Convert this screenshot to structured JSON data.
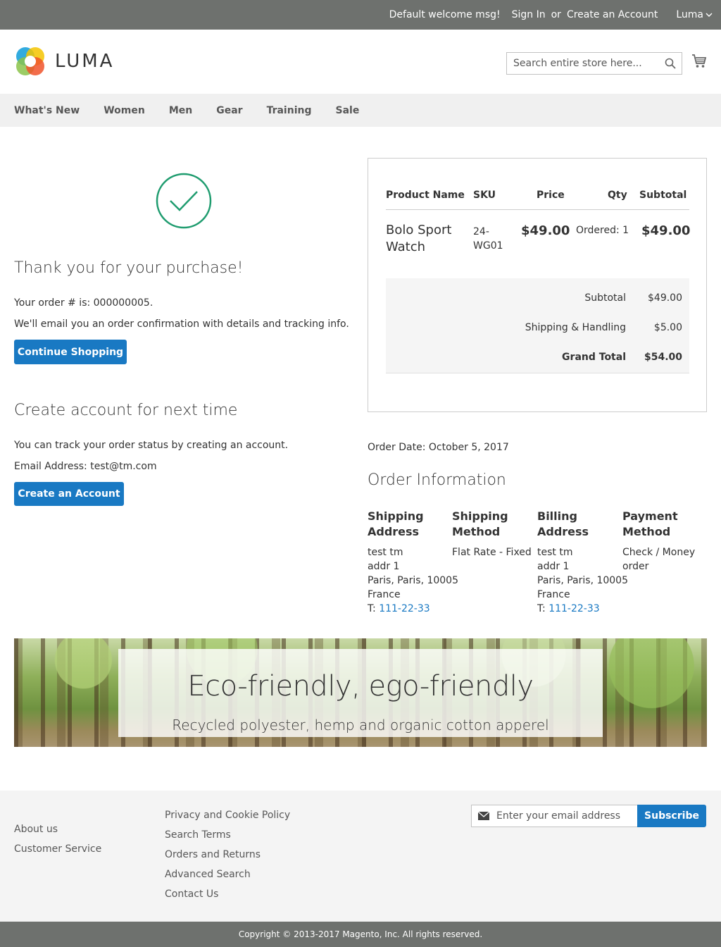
{
  "topbar": {
    "welcome": "Default welcome msg!",
    "sign_in": "Sign In",
    "or": "or",
    "create_account": "Create an Account",
    "store": "Luma"
  },
  "header": {
    "logo_text": "LUMA",
    "search_placeholder": "Search entire store here..."
  },
  "nav": [
    "What's New",
    "Women",
    "Men",
    "Gear",
    "Training",
    "Sale"
  ],
  "success": {
    "title": "Thank you for your purchase!",
    "order_number": "Your order # is: 000000005.",
    "email_note": "We'll email you an order confirmation with details and tracking info.",
    "continue_label": "Continue Shopping"
  },
  "create": {
    "title": "Create account for next time",
    "track_note": "You can track your order status by creating an account.",
    "email": "Email Address: test@tm.com",
    "button": "Create an Account"
  },
  "summary": {
    "headers": {
      "product": "Product Name",
      "sku": "SKU",
      "price": "Price",
      "qty": "Qty",
      "subtotal": "Subtotal"
    },
    "item": {
      "name": "Bolo Sport Watch",
      "sku": "24-WG01",
      "price": "$49.00",
      "qty": "Ordered: 1",
      "subtotal": "$49.00"
    },
    "totals": [
      {
        "label": "Subtotal",
        "value": "$49.00"
      },
      {
        "label": "Shipping & Handling",
        "value": "$5.00"
      },
      {
        "label": "Grand Total",
        "value": "$54.00"
      }
    ]
  },
  "order": {
    "date": "Order Date: October 5, 2017",
    "info_title": "Order Information",
    "shipping_address": {
      "title": "Shipping Address",
      "lines": [
        "test tm",
        "addr 1",
        "Paris, Paris, 10005",
        "France"
      ],
      "phone_prefix": "T:",
      "phone": "111-22-33"
    },
    "shipping_method": {
      "title": "Shipping Method",
      "value": "Flat Rate - Fixed"
    },
    "billing_address": {
      "title": "Billing Address",
      "lines": [
        "test tm",
        "addr 1",
        "Paris, Paris, 10005",
        "France"
      ],
      "phone_prefix": "T:",
      "phone": "111-22-33"
    },
    "payment_method": {
      "title": "Payment Method",
      "value": "Check / Money order"
    }
  },
  "banner": {
    "heading": "Eco-friendly, ego-friendly",
    "subheading": "Recycled polyester, hemp and organic cotton apperel"
  },
  "footer": {
    "col1": [
      "About us",
      "Customer Service"
    ],
    "col2": [
      "Privacy and Cookie Policy",
      "Search Terms",
      "Orders and Returns",
      "Advanced Search",
      "Contact Us"
    ],
    "newsletter_placeholder": "Enter your email address",
    "subscribe_label": "Subscribe",
    "copyright": "Copyright © 2013-2017 Magento, Inc. All rights reserved."
  },
  "colors": {
    "accent": "#1979c3",
    "success": "#1f9c6f",
    "topbar": "#6e716e"
  },
  "icons": [
    "search-icon",
    "cart-icon",
    "checkmark-icon",
    "envelope-icon",
    "chevron-down-icon"
  ]
}
